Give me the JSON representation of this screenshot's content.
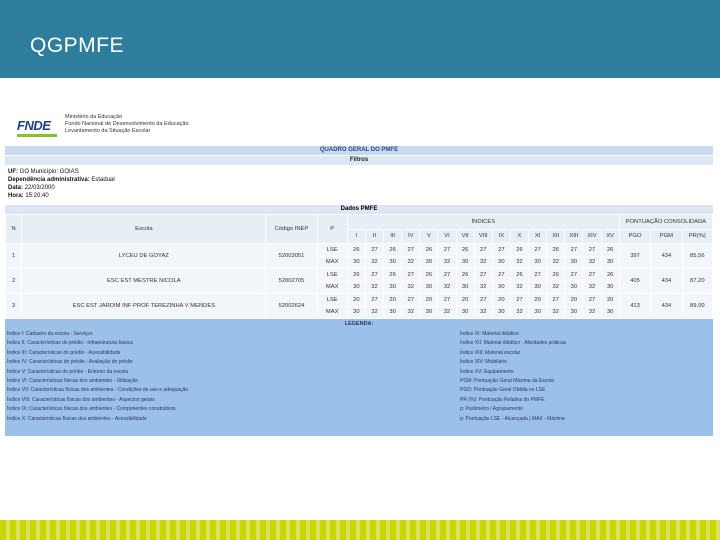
{
  "slide": {
    "title": "QGPMFE"
  },
  "report": {
    "ministry_lines": [
      "Ministério da Educação",
      "Fundo Nacional de Desenvolvimento da Educação",
      "Levantamento da Situação Escolar"
    ],
    "logo_text": "FNDE",
    "main_title": "QUADRO GERAL DO PMFE",
    "filters_title": "Filtros",
    "filters": [
      {
        "label": "UF:",
        "value": "GO Município: GOIAS"
      },
      {
        "label": "Dependência administrativa:",
        "value": "Estadual"
      },
      {
        "label": "Data:",
        "value": "22/03/2000"
      },
      {
        "label": "Hora:",
        "value": "15:20:40"
      }
    ],
    "dados_title": "Dados PMFE",
    "columns": {
      "n": "N",
      "escola": "Escola",
      "codigo": "Código INEP",
      "p": "P",
      "indices": "ÍNDICES",
      "pontuacao": "PONTUAÇÃO CONSOLIDADA",
      "index_headers": [
        "I",
        "II",
        "III",
        "IV",
        "V",
        "VI",
        "VII",
        "VIII",
        "IX",
        "X",
        "XI",
        "XII",
        "XIII",
        "XIV",
        "XV"
      ],
      "score_headers": [
        "PGO",
        "PGM",
        "PR(%)"
      ]
    },
    "schools": [
      {
        "n": "1",
        "escola": "LYCEU DE GOYAZ",
        "codigo": "52003051",
        "lse": {
          "p": "LSE",
          "vals": [
            "26",
            "27",
            "26",
            "27",
            "26",
            "27",
            "26",
            "27",
            "27",
            "26",
            "27",
            "26",
            "27",
            "27",
            "26"
          ]
        },
        "max": {
          "p": "MAX",
          "vals": [
            "30",
            "32",
            "30",
            "32",
            "30",
            "32",
            "30",
            "32",
            "30",
            "32",
            "30",
            "32",
            "30",
            "32",
            "30"
          ]
        },
        "pgo": "397",
        "pgm": "434",
        "pr": "85,56"
      },
      {
        "n": "2",
        "escola": "ESC EST MESTRE NICOLA",
        "codigo": "52002705",
        "lse": {
          "p": "LSE",
          "vals": [
            "26",
            "27",
            "26",
            "27",
            "26",
            "27",
            "26",
            "27",
            "27",
            "26",
            "27",
            "26",
            "27",
            "27",
            "26"
          ]
        },
        "max": {
          "p": "MAX",
          "vals": [
            "30",
            "32",
            "30",
            "32",
            "30",
            "32",
            "30",
            "32",
            "30",
            "32",
            "30",
            "32",
            "30",
            "32",
            "30"
          ]
        },
        "pgo": "405",
        "pgm": "434",
        "pr": "87,20"
      },
      {
        "n": "3",
        "escola": "ESC EST JARDIM INF PROF TEREZINHA V MENDES",
        "codigo": "52002624",
        "lse": {
          "p": "LSE",
          "vals": [
            "20",
            "27",
            "20",
            "27",
            "20",
            "27",
            "20",
            "27",
            "20",
            "27",
            "20",
            "27",
            "20",
            "27",
            "20"
          ]
        },
        "max": {
          "p": "MAX",
          "vals": [
            "30",
            "32",
            "30",
            "32",
            "30",
            "32",
            "30",
            "32",
            "30",
            "32",
            "30",
            "32",
            "30",
            "32",
            "30"
          ]
        },
        "pgo": "413",
        "pgm": "434",
        "pr": "89,00"
      }
    ],
    "legend_title": "LEGENDA:",
    "legend_left": [
      "Índice I: Cadastro da escola - Serviços",
      "Índice II: Características do prédio - Infraestrutura básica",
      "Índice III: Características do prédio - Acessibilidade",
      "Índice IV: Características do prédio - Avaliação do prédio",
      "Índice V: Características do prédio - Entorno da escola",
      "Índice VI: Características físicas dos ambientes - Utilização",
      "Índice VII: Características físicas dos ambientes - Condições de uso e adequação",
      "Índice VIII: Características físicas dos ambientes - Aspectos gerais",
      "Índice IX: Características físicas dos ambientes - Componentes construtivos",
      "Índice X: Características físicas dos ambientes - Acessibilidade"
    ],
    "legend_right": [
      "Índice XI: Material didático",
      "Índice XII: Material didático - Atividades práticas",
      "Índice XIII: Material escolar",
      "Índice XIV: Mobiliário",
      "Índice XV: Equipamento",
      "PGM: Pontuação Geral Máxima da Escola",
      "PGO: Pontuação Geral Obtida no LSE",
      "PR (%): Pontuação Relativa do PMFE",
      "p: Parâmetro / Agrupamento",
      "p: Pontuação LSE - Alcançada | MAX - Máxima"
    ]
  }
}
